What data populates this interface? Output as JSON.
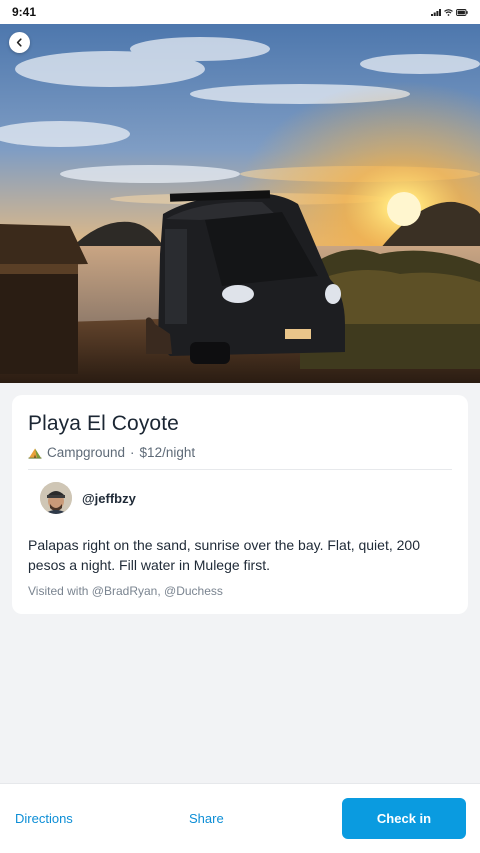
{
  "status_bar": {
    "time": "9:41",
    "icons": [
      "signal-icon",
      "wifi-icon",
      "battery-icon"
    ]
  },
  "hero": {
    "back_icon": "chevron-left-icon"
  },
  "place": {
    "title": "Playa El Coyote",
    "category_icon": "tent-icon",
    "category": "Campground",
    "separator": "·",
    "price": "$12/night"
  },
  "author": {
    "username": "@jeffbzy"
  },
  "review": {
    "text": "Palapas right on the sand, sunrise over the bay. Flat, quiet, 200 pesos a night. Fill water in Mulege first.",
    "visited_with": "Visited with @BradRyan, @Duchess"
  },
  "actions": {
    "directions": "Directions",
    "share": "Share",
    "check_in": "Check in"
  },
  "colors": {
    "accent": "#0a9be0",
    "link": "#0d8ed6",
    "background": "#f2f3f5"
  }
}
